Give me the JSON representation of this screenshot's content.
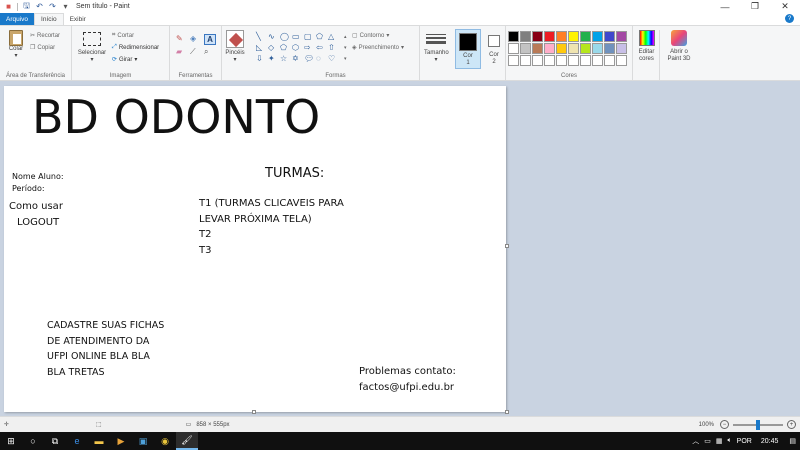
{
  "window": {
    "title": "Sem título - Paint",
    "controls": {
      "minimize": "—",
      "maximize": "❐",
      "close": "✕"
    }
  },
  "quick_access": [
    "save-icon",
    "undo-icon",
    "redo-icon",
    "customize-icon"
  ],
  "tabs": {
    "file": "Arquivo",
    "home": "Início",
    "view": "Exibir"
  },
  "ribbon": {
    "clipboard": {
      "paste": "Colar",
      "cut": "Recortar",
      "copy": "Copiar",
      "group": "Área de Transferência"
    },
    "image": {
      "select": "Selecionar",
      "crop": "Cortar",
      "resize": "Redimensionar",
      "rotate": "Girar",
      "group": "Imagem"
    },
    "tools": {
      "group": "Ferramentas"
    },
    "brushes": {
      "label": "Pincéis"
    },
    "shapes": {
      "outline": "Contorno",
      "fill": "Preenchimento",
      "group": "Formas"
    },
    "size": {
      "label": "Tamanho"
    },
    "color1": {
      "label": "Cor\n1"
    },
    "color2": {
      "label": "Cor\n2"
    },
    "colors": {
      "group": "Cores",
      "row1": [
        "#000000",
        "#7f7f7f",
        "#880015",
        "#ed1c24",
        "#ff7f27",
        "#fff200",
        "#22b14c",
        "#00a2e8",
        "#3f48cc",
        "#a349a4"
      ],
      "row2": [
        "#ffffff",
        "#c3c3c3",
        "#b97a57",
        "#ffaec9",
        "#ffc90e",
        "#efe4b0",
        "#b5e61d",
        "#99d9ea",
        "#7092be",
        "#c8bfe7"
      ],
      "row3": [
        "#ffffff",
        "#ffffff",
        "#ffffff",
        "#ffffff",
        "#ffffff",
        "#ffffff",
        "#ffffff",
        "#ffffff",
        "#ffffff",
        "#ffffff"
      ]
    },
    "edit_colors": {
      "label": "Editar\ncores"
    },
    "paint3d": {
      "label": "Abrir o\nPaint 3D"
    }
  },
  "canvas": {
    "title": "BD ODONTO",
    "nome_aluno": "Nome Aluno:",
    "periodo": "Período:",
    "como_usar": "Como usar",
    "logout": "LOGOUT",
    "turmas_title": "TURMAS:",
    "turmas_list": "T1 (TURMAS CLICAVEIS PARA\nLEVAR PRÓXIMA TELA)\nT2\nT3",
    "cadastre": "CADASTRE SUAS FICHAS\nDE ATENDIMENTO DA\nUFPI ONLINE BLA BLA\nBLA TRETAS",
    "problemas": "Problemas contato:",
    "email": "factos@ufpi.edu.br"
  },
  "status": {
    "dimensions": "858 × 555px",
    "zoom": "100%"
  },
  "taskbar": {
    "language": "POR",
    "time": "20:45"
  }
}
